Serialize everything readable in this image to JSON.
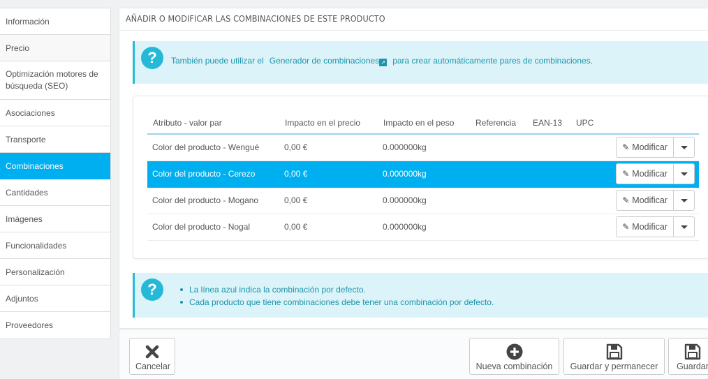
{
  "sidebar": {
    "items": [
      {
        "label": "Información"
      },
      {
        "label": "Precio"
      },
      {
        "label": "Optimización motores de búsqueda (SEO)"
      },
      {
        "label": "Asociaciones"
      },
      {
        "label": "Transporte"
      },
      {
        "label": "Combinaciones"
      },
      {
        "label": "Cantidades"
      },
      {
        "label": "Imágenes"
      },
      {
        "label": "Funcionalidades"
      },
      {
        "label": "Personalización"
      },
      {
        "label": "Adjuntos"
      },
      {
        "label": "Proveedores"
      }
    ],
    "active": "Combinaciones"
  },
  "panel": {
    "title": "Añadir o modificar las combinaciones de este producto"
  },
  "alert_top": {
    "before": "También puede utilizar el",
    "link": "Generador de combinaciones",
    "after": "para crear automáticamente pares de combinaciones."
  },
  "table": {
    "headers": [
      "Atributo - valor par",
      "Impacto en el precio",
      "Impacto en el peso",
      "Referencia",
      "EAN-13",
      "UPC"
    ],
    "rows": [
      {
        "attr": "Color del producto - Wengué",
        "price": "0,00 €",
        "weight": "0.000000kg",
        "ref": "",
        "ean": "",
        "upc": ""
      },
      {
        "attr": "Color del producto - Cerezo",
        "price": "0,00 €",
        "weight": "0.000000kg",
        "ref": "",
        "ean": "",
        "upc": ""
      },
      {
        "attr": "Color del producto - Mogano",
        "price": "0,00 €",
        "weight": "0.000000kg",
        "ref": "",
        "ean": "",
        "upc": ""
      },
      {
        "attr": "Color del producto - Nogal",
        "price": "0,00 €",
        "weight": "0.000000kg",
        "ref": "",
        "ean": "",
        "upc": ""
      }
    ],
    "default_row": "Color del producto - Cerezo",
    "edit_label": "Modificar"
  },
  "alert_bottom": {
    "items": [
      "La línea azul indica la combinación por defecto.",
      "Cada producto que tiene combinaciones debe tener una combinación por defecto."
    ]
  },
  "footer": {
    "cancel": "Cancelar",
    "new_combination": "Nueva combinación",
    "save_stay": "Guardar y permanecer",
    "save": "Guardar"
  },
  "colors": {
    "accent": "#00aff0",
    "info_bg": "#dcf4f9",
    "info_text": "#1e94ab",
    "info_icon": "#25b9d7"
  }
}
